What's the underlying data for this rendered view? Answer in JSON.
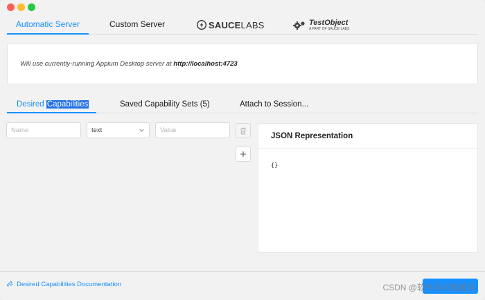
{
  "server_tabs": {
    "automatic": "Automatic Server",
    "custom": "Custom Server",
    "sauce_logo_bold": "SAUCE",
    "sauce_logo_thin": "LABS",
    "testobject_logo": "TestObject",
    "testobject_sub": "A PART OF SAUCE LABS"
  },
  "server_panel": {
    "message_prefix": "Will use currently-running Appium Desktop server at ",
    "server_url": "http://localhost:4723"
  },
  "capability_tabs": {
    "desired_part1": "Desired ",
    "desired_part2": "Capabilities",
    "saved": "Saved Capability Sets (5)",
    "attach": "Attach to Session..."
  },
  "capability_row": {
    "name_placeholder": "Name",
    "type_value": "text",
    "value_placeholder": "Value"
  },
  "json_panel": {
    "title": "JSON Representation",
    "content": "{}"
  },
  "footer": {
    "doc_link": "Desired Capabilities Documentation",
    "watermark": "CSDN @软件测试情报局"
  },
  "colors": {
    "accent": "#1890ff",
    "selection": "#1f6fe5",
    "close": "#fe5f57",
    "minimize": "#febc2e",
    "maximize": "#28c840"
  },
  "icons": [
    "trash-icon",
    "plus-icon",
    "chevron-down-icon",
    "link-icon",
    "gear-icon"
  ]
}
